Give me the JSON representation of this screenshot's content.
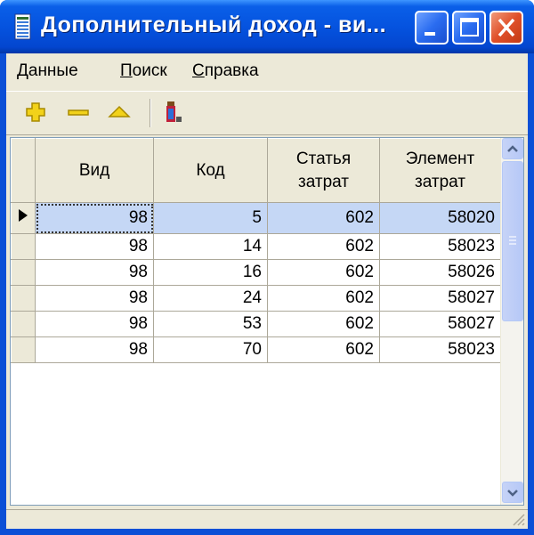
{
  "window": {
    "title": "Дополнительный доход - ви...",
    "controls": [
      "minimize",
      "maximize",
      "close"
    ]
  },
  "menu": {
    "items": [
      {
        "label": "Данные",
        "mnemonic": "Д",
        "rest": "анные"
      },
      {
        "label": "Поиск",
        "mnemonic": "П",
        "rest": "оиск"
      },
      {
        "label": "Справка",
        "mnemonic": "С",
        "rest": "правка"
      }
    ]
  },
  "toolbar": {
    "icons": [
      "add-icon",
      "delete-icon",
      "post-icon",
      "filter-icon"
    ]
  },
  "grid": {
    "columns": [
      {
        "line1": "Вид",
        "line2": ""
      },
      {
        "line1": "Код",
        "line2": ""
      },
      {
        "line1": "Статья",
        "line2": "затрат"
      },
      {
        "line1": "Элемент",
        "line2": "затрат"
      }
    ],
    "rows": [
      [
        "98",
        "5",
        "602",
        "58020"
      ],
      [
        "98",
        "14",
        "602",
        "58023"
      ],
      [
        "98",
        "16",
        "602",
        "58026"
      ],
      [
        "98",
        "24",
        "602",
        "58027"
      ],
      [
        "98",
        "53",
        "602",
        "58027"
      ],
      [
        "98",
        "70",
        "602",
        "58023"
      ]
    ],
    "selected_row": 0
  },
  "colors": {
    "titlebar": "#0553df",
    "selection": "#c5d7f5",
    "face": "#ece9d8"
  }
}
